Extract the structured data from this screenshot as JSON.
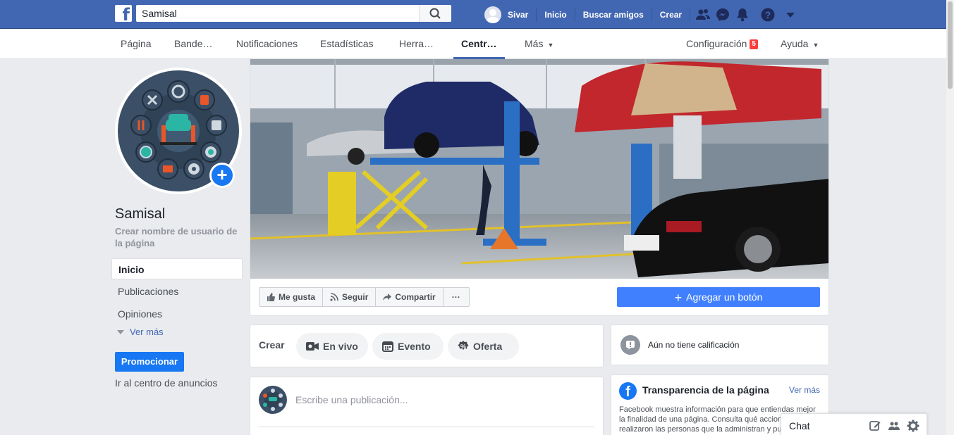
{
  "topbar": {
    "search_value": "Samisal",
    "user_name": "Sivar",
    "links": [
      "Inicio",
      "Buscar amigos",
      "Crear"
    ]
  },
  "subnav": {
    "items": [
      "Página",
      "Bande…",
      "Notificaciones",
      "Estadísticas",
      "Herra…",
      "Centr…",
      "Más",
      "Configuración",
      "Ayuda"
    ],
    "settings_badge": "5"
  },
  "sidebar": {
    "page_name": "Samisal",
    "username_prompt": "Crear nombre de usuario de la página",
    "nav": [
      "Inicio",
      "Publicaciones",
      "Opiniones"
    ],
    "see_more": "Ver más",
    "promote": "Promocionar",
    "ads_center": "Ir al centro de anuncios"
  },
  "actions": {
    "like": "Me gusta",
    "follow": "Seguir",
    "share": "Compartir",
    "more": "···",
    "add_button": "Agregar un botón"
  },
  "create": {
    "label": "Crear",
    "live": "En vivo",
    "event": "Evento",
    "offer": "Oferta",
    "placeholder": "Escribe una publicación..."
  },
  "right": {
    "rating": "Aún no tiene calificación",
    "transparency_title": "Transparencia de la página",
    "transparency_more": "Ver más",
    "transparency_body": "Facebook muestra información para que entiendas mejor la finalidad de una página. Consulta qué acciones realizaron las personas que la administran y pu"
  },
  "chat": {
    "label": "Chat"
  },
  "colors": {
    "brand": "#4267b2",
    "button_blue": "#1877f2",
    "badge_red": "#fa3e3e"
  },
  "icons": [
    "facebook-logo",
    "search-icon",
    "friends-icon",
    "messenger-icon",
    "bell-icon",
    "help-icon",
    "dropdown-icon",
    "like-icon",
    "rss-icon",
    "share-icon",
    "live-icon",
    "calendar-icon",
    "offer-icon",
    "rating-icon",
    "facebook-circle-icon",
    "compose-icon",
    "group-icon",
    "gear-icon"
  ]
}
